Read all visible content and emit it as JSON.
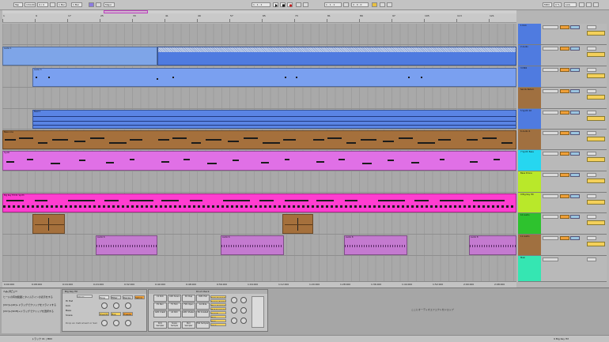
{
  "transport": {
    "tempo": "134.00",
    "signature": "4 / 4",
    "quantize": "1 Bar",
    "metronome_label": "Major",
    "position": "1 . 1 . 1",
    "loop_start": "1 . 1 . 1",
    "loop_length": "4 . 0 . 0",
    "key_label": "MIDI",
    "cpu": "0 %",
    "link": "Link",
    "tap": "Tap"
  },
  "ruler": {
    "marks": [
      "1",
      "9",
      "17",
      "25",
      "33",
      "41",
      "49",
      "57",
      "65",
      "73",
      "81",
      "89",
      "97",
      "105",
      "113",
      "121",
      "129",
      "137",
      "145",
      "153",
      "161",
      "169",
      "177",
      "185",
      "193",
      "201",
      "209",
      "217",
      "225",
      "233",
      "241",
      "249"
    ]
  },
  "tracks": [
    {
      "name": "1 Kick",
      "color": "#4f7be0"
    },
    {
      "name": "2 Audio",
      "color": "#4f7be0"
    },
    {
      "name": "3 MIDI",
      "color": "#4f7be0"
    },
    {
      "name": "Sends Return",
      "color": "#a07040"
    },
    {
      "name": "5 Synth 02",
      "color": "#4f7be0"
    },
    {
      "name": "6 Audio 6",
      "color": "#a07040"
    },
    {
      "name": "7 Synth Bass",
      "color": "#26d6f0"
    },
    {
      "name": "Bass Drone",
      "color": "#b9e82a"
    },
    {
      "name": "9 Big Key Hit",
      "color": "#b9e82a"
    },
    {
      "name": "10 Audio",
      "color": "#2ec22e"
    },
    {
      "name": "11 Audio",
      "color": "#a07040"
    },
    {
      "name": "Main",
      "color": "#35e6b2"
    }
  ],
  "lanes": {
    "clip_names": [
      "Audio 1",
      "Audio 2",
      "Audio 3",
      "Beat 3",
      "Bass Line",
      "Synth",
      "Big Key Hit 01 Synth",
      "Audio 6",
      "Audio 8"
    ]
  },
  "timeline": {
    "labels": [
      "0:00:000",
      "0:08:000",
      "0:16:000",
      "0:24:000",
      "0:32:000",
      "0:40:000",
      "0:48:000",
      "0:56:000",
      "1:04:000",
      "1:12:000",
      "1:20:000",
      "1:28:000",
      "1:36:000",
      "1:44:000",
      "1:52:000",
      "2:00:000",
      "2:08:000"
    ]
  },
  "info_view": {
    "title": "ヘルプビュー",
    "lines": [
      "ヒールの有効範囲とタイムラインの表示をする",
      "[Ctrl]+[Alt]+ドラッグでクリップをスライドする",
      "[Ctrl]+[Shift]+ドラッグでクリップを選択する"
    ]
  },
  "device": {
    "title": "Big Key Hit",
    "chain_label": "Chain",
    "rows": [
      "Hi Hat",
      "Kick",
      "Bass",
      "Snare"
    ],
    "tabs": [
      "Tone",
      "Filter",
      "Decay",
      "Swing"
    ],
    "buttons": [
      "Overdrive",
      "Bus",
      "Freeze"
    ],
    "hint": "Drop an Instrument or Sample here"
  },
  "drum_rack": {
    "title": "Drum Rack",
    "pads": [
      "C1 Kick",
      "C#1 Snare",
      "D1 Clap",
      "D#1 Hat",
      "E1 Perc",
      "F1 Tom",
      "F#1 Open",
      "G1 Ride",
      "G#1 Crash",
      "A1 Rim",
      "A#1 Shaker",
      "B1 Cowbell",
      "Kick Sampler",
      "Snare Sample",
      "Perc Sampler",
      "Hat Sampler"
    ],
    "chain_list": [
      "Kick Sampler",
      "Snare Sampler",
      "Perc Sampler",
      "Hat Sampler",
      "Crash",
      "Tom",
      "Rim",
      "Clap"
    ]
  },
  "detail_hint": "ここにオーディオエフェクトをドロップ",
  "status": {
    "left": "トラック 01 | MIDI",
    "right": "9 Big Key Hit"
  }
}
